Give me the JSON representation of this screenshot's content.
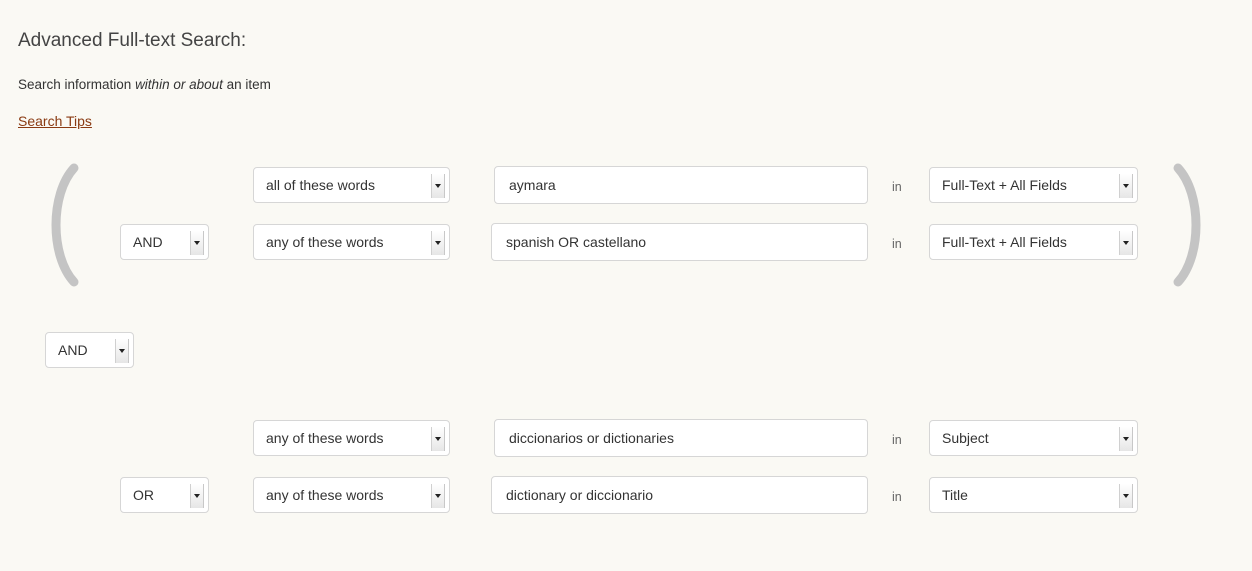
{
  "title": "Advanced Full-text Search:",
  "subtitle": {
    "before": "Search information ",
    "emphasis": "within or about",
    "after": " an item"
  },
  "search_tips": "Search Tips",
  "in_label": "in",
  "group_join_operator": "AND",
  "groups": [
    {
      "rows": [
        {
          "operator": null,
          "word_match": "all of these words",
          "query": "aymara",
          "field": "Full-Text + All Fields"
        },
        {
          "operator": "AND",
          "word_match": "any of these words",
          "query": "spanish OR castellano",
          "field": "Full-Text + All Fields"
        }
      ]
    },
    {
      "rows": [
        {
          "operator": null,
          "word_match": "any of these words",
          "query": "diccionarios or dictionaries",
          "field": "Subject"
        },
        {
          "operator": "OR",
          "word_match": "any of these words",
          "query": "dictionary or diccionario",
          "field": "Title"
        }
      ]
    }
  ],
  "icons": {
    "open_paren": "open-paren-icon",
    "close_paren": "close-paren-icon",
    "select_arrow": "chevron-down-icon"
  },
  "colors": {
    "background": "#faf9f4",
    "link": "#8a3a12",
    "paren": "#c4c4c4"
  }
}
